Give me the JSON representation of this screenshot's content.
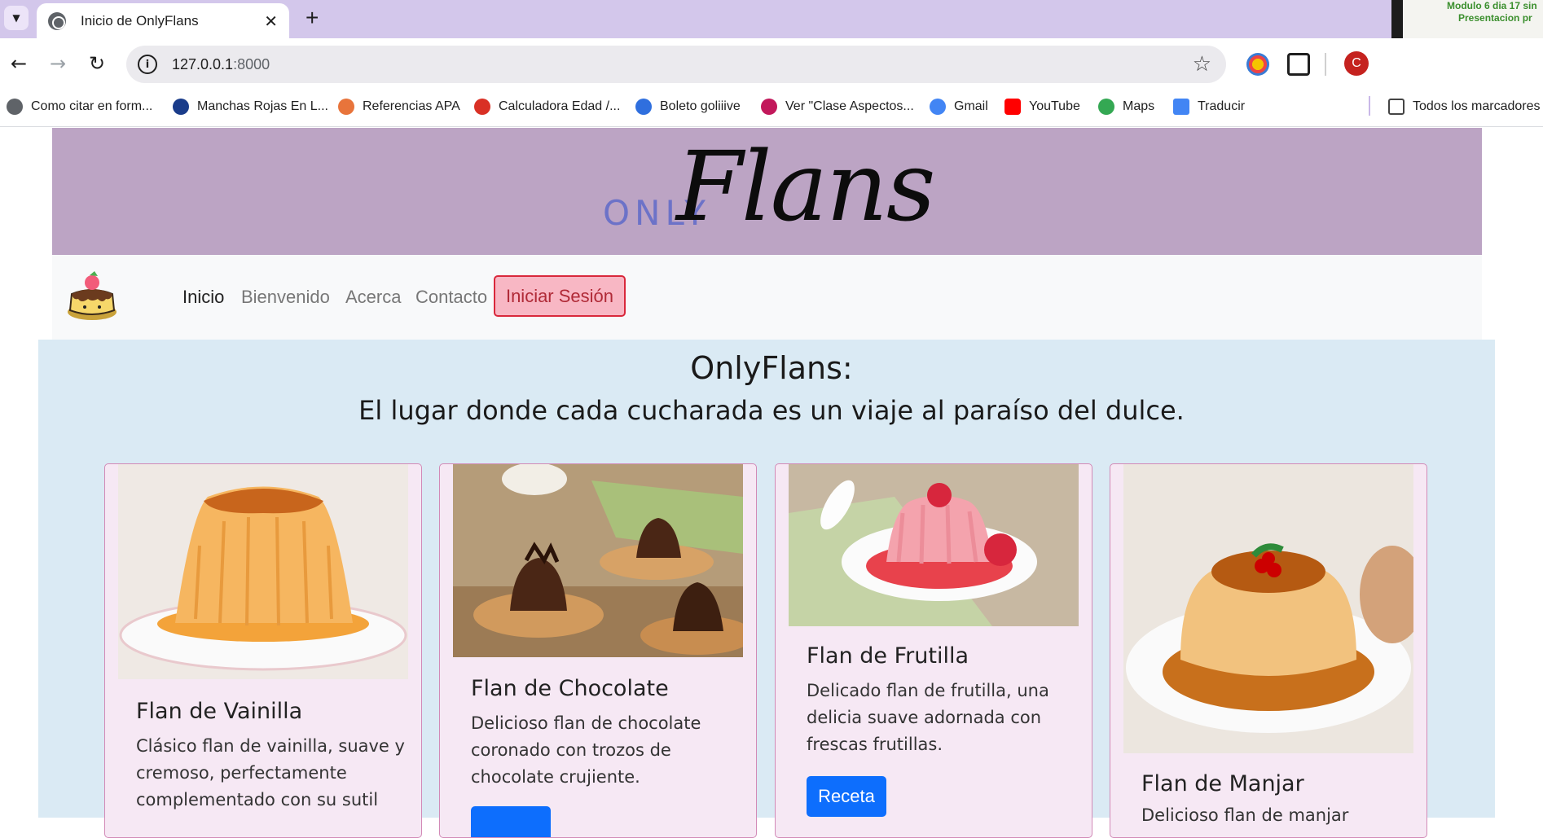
{
  "browser": {
    "tab_title": "Inicio de OnlyFlans",
    "url_host": "127.0.0.1",
    "url_port": ":8000",
    "profile_initial": "C",
    "bookmarks": [
      {
        "label": "Como citar en form...",
        "icon": "globe-icon",
        "color": "#5f6368"
      },
      {
        "label": "Manchas Rojas En L...",
        "icon": "apple-icon",
        "color": "#1a3c8a"
      },
      {
        "label": "Referencias APA",
        "icon": "cap-icon",
        "color": "#e8743b"
      },
      {
        "label": "Calculadora Edad /...",
        "icon": "calc-icon",
        "color": "#d93025"
      },
      {
        "label": "Boleto goliiive",
        "icon": "bars-icon",
        "color": "#2f6fde"
      },
      {
        "label": "Ver \"Clase Aspectos...",
        "icon": "play-icon",
        "color": "#c2185b"
      },
      {
        "label": "Gmail",
        "icon": "google-icon",
        "color": "#4285f4"
      },
      {
        "label": "YouTube",
        "icon": "youtube-icon",
        "color": "#ff0000"
      },
      {
        "label": "Maps",
        "icon": "maps-icon",
        "color": "#34a853"
      },
      {
        "label": "Traducir",
        "icon": "translate-icon",
        "color": "#4285f4"
      }
    ],
    "all_bookmarks_label": "Todos los marcadores",
    "overlay_line1": "Modulo 6 dia 17 sin",
    "overlay_line2": "Presentacion pr"
  },
  "site": {
    "logo_only": "ONLY",
    "logo_flans": "Flans",
    "nav": {
      "inicio": "Inicio",
      "bienvenido": "Bienvenido",
      "acerca": "Acerca",
      "contacto": "Contacto",
      "login": "Iniciar Sesión"
    },
    "hero_title": "OnlyFlans:",
    "hero_subtitle": "El lugar donde cada cucharada es un viaje al paraíso del dulce.",
    "cards": [
      {
        "title": "Flan de Vainilla",
        "text": "Clásico flan de vainilla, suave y cremoso, perfectamente complementado con su sutil",
        "button": ""
      },
      {
        "title": "Flan de Chocolate",
        "text": "Delicioso flan de chocolate coronado con trozos de chocolate crujiente.",
        "button": ""
      },
      {
        "title": "Flan de Frutilla",
        "text": "Delicado flan de frutilla, una delicia suave adornada con frescas frutillas.",
        "button": "Receta"
      },
      {
        "title": "Flan de Manjar",
        "text": "Delicioso flan de manjar",
        "button": ""
      }
    ]
  },
  "colors": {
    "header": "#bca4c4",
    "hero": "#daeaf4",
    "card": "#f6e8f4",
    "button": "#0d6efd",
    "login": "#f8b7c4"
  }
}
